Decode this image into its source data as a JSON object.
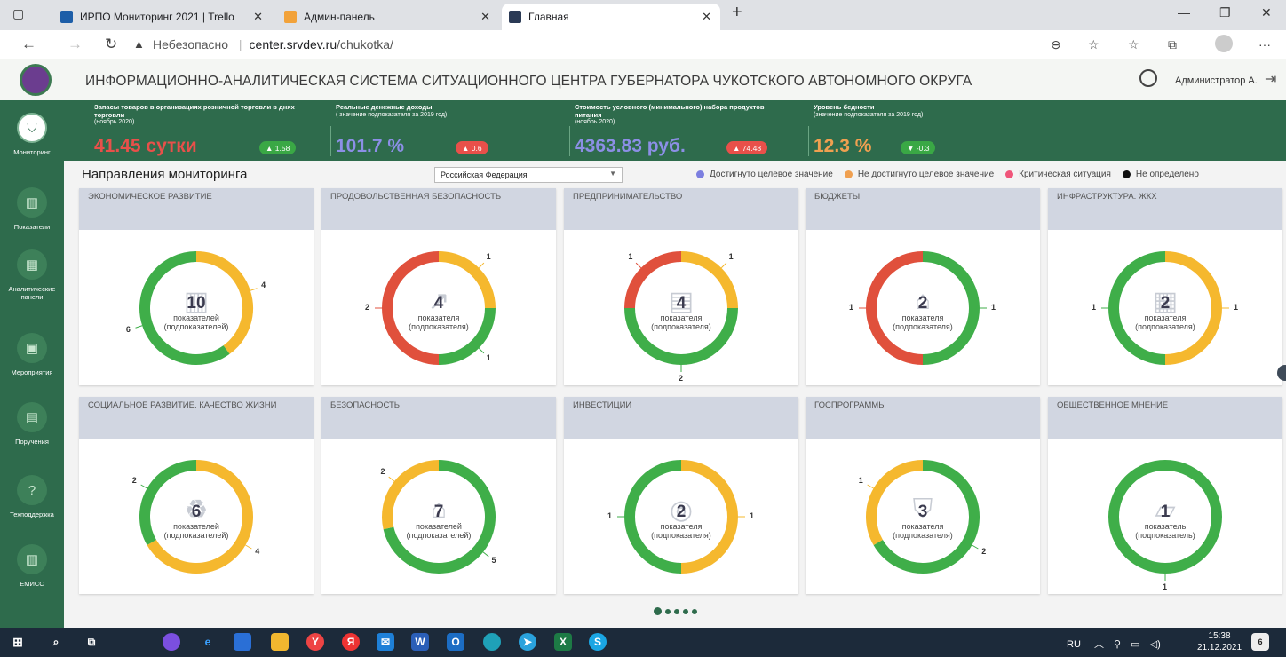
{
  "browser": {
    "tabs": [
      {
        "title": "ИРПО Мониторинг 2021 | Trello"
      },
      {
        "title": "Админ-панель"
      },
      {
        "title": "Главная"
      }
    ],
    "new_tab": "+",
    "security_label": "Небезопасно",
    "url_host": "center.srvdev.ru",
    "url_path": "/chukotka/"
  },
  "header": {
    "title": "ИНФОРМАЦИОННО-АНАЛИТИЧЕСКАЯ СИСТЕМА СИТУАЦИОННОГО ЦЕНТРА ГУБЕРНАТОРА ЧУКОТСКОГО АВТОНОМНОГО ОКРУГА",
    "user": "Администратор А."
  },
  "sidebar": [
    {
      "label": "Мониторинг",
      "icon": "shield-icon"
    },
    {
      "label": "Показатели",
      "icon": "bar-chart-icon"
    },
    {
      "label": "Аналитические панели",
      "icon": "grid-icon"
    },
    {
      "label": "Мероприятия",
      "icon": "calendar-icon"
    },
    {
      "label": "Поручения",
      "icon": "briefcase-icon"
    },
    {
      "label": "Техподдержка",
      "icon": "help-icon"
    },
    {
      "label": "ЕМИСС",
      "icon": "bar-chart-icon"
    }
  ],
  "kpis": [
    {
      "title": "Запасы товаров в организациях розничной торговли в днях торговли",
      "sub": "(ноябрь 2020)",
      "value": "41.45 сутки",
      "value_color": "#e8504a",
      "badge": "▲ 1.58",
      "badge_color": "#3aa845"
    },
    {
      "title": "Реальные денежные доходы",
      "sub": "( значение подпоказателя за 2019 год)",
      "value": "101.7 %",
      "value_color": "#8c8fe6",
      "badge": "▲ 0.6",
      "badge_color": "#e8504a"
    },
    {
      "title": "Стоимость условного (минимального) набора продуктов питания",
      "sub": "(ноябрь 2020)",
      "value": "4363.83 руб.",
      "value_color": "#8c8fe6",
      "badge": "▲ 74.48",
      "badge_color": "#e8504a"
    },
    {
      "title": "Уровень бедности",
      "sub": "(значение подпоказателя за 2019 год)",
      "value": "12.3 %",
      "value_color": "#f0a050",
      "badge": "▼ -0.3",
      "badge_color": "#3aa845"
    }
  ],
  "section": {
    "title": "Направления мониторинга",
    "region": "Российская Федерация",
    "legend": [
      {
        "label": "Достигнуто целевое значение",
        "color": "#7c7fe0"
      },
      {
        "label": "Не достигнуто целевое значение",
        "color": "#f0a050"
      },
      {
        "label": "Критическая ситуация",
        "color": "#f0557a"
      },
      {
        "label": "Не определено",
        "color": "#111111"
      }
    ]
  },
  "colors": {
    "green": "#3fae49",
    "yellow": "#f5b82e",
    "red": "#e0503c"
  },
  "cards": [
    {
      "title": "ЭКОНОМИЧЕСКОЕ РАЗВИТИЕ",
      "count": "10",
      "label1": "показателей",
      "label2": "(подпоказателей)",
      "icon": "bar-chart-icon",
      "segments": [
        {
          "color": "yellow",
          "value": 4
        },
        {
          "color": "green",
          "value": 6
        }
      ],
      "labels": [
        {
          "text": "4"
        },
        {
          "text": "6"
        }
      ]
    },
    {
      "title": "ПРОДОВОЛЬСТВЕННАЯ БЕЗОПАСНОСТЬ",
      "count": "4",
      "label1": "показателя",
      "label2": "(подпоказателя)",
      "icon": "growth-chart-icon",
      "segments": [
        {
          "color": "yellow",
          "value": 1
        },
        {
          "color": "green",
          "value": 1
        },
        {
          "color": "red",
          "value": 2
        }
      ],
      "labels": [
        {
          "text": "1"
        },
        {
          "text": "1"
        },
        {
          "text": "2"
        }
      ]
    },
    {
      "title": "ПРЕДПРИНИМАТЕЛЬСТВО",
      "count": "4",
      "label1": "показателя",
      "label2": "(подпоказателя)",
      "icon": "briefcase-icon",
      "segments": [
        {
          "color": "yellow",
          "value": 1
        },
        {
          "color": "green",
          "value": 2
        },
        {
          "color": "red",
          "value": 1
        }
      ],
      "labels": [
        {
          "text": "1"
        },
        {
          "text": "2"
        },
        {
          "text": "1"
        }
      ]
    },
    {
      "title": "БЮДЖЕТЫ",
      "count": "2",
      "label1": "показателя",
      "label2": "(подпоказателя)",
      "icon": "bank-icon",
      "segments": [
        {
          "color": "green",
          "value": 1
        },
        {
          "color": "red",
          "value": 1
        }
      ],
      "labels": [
        {
          "text": "1"
        },
        {
          "text": "1"
        }
      ]
    },
    {
      "title": "ИНФРАСТРУКТУРА. ЖКХ",
      "count": "2",
      "label1": "показателя",
      "label2": "(подпоказателя)",
      "icon": "building-icon",
      "segments": [
        {
          "color": "yellow",
          "value": 1
        },
        {
          "color": "green",
          "value": 1
        }
      ],
      "labels": [
        {
          "text": "1"
        },
        {
          "text": "1"
        }
      ]
    },
    {
      "title": "СОЦИАЛЬНОЕ РАЗВИТИЕ. КАЧЕСТВО ЖИЗНИ",
      "count": "6",
      "label1": "показателей",
      "label2": "(подпоказателей)",
      "icon": "recycle-icon",
      "segments": [
        {
          "color": "yellow",
          "value": 4
        },
        {
          "color": "green",
          "value": 2
        }
      ],
      "labels": [
        {
          "text": "4"
        },
        {
          "text": "2"
        }
      ]
    },
    {
      "title": "БЕЗОПАСНОСТЬ",
      "count": "7",
      "label1": "показателей",
      "label2": "(подпоказателей)",
      "icon": "house-icon",
      "segments": [
        {
          "color": "green",
          "value": 5
        },
        {
          "color": "yellow",
          "value": 2
        }
      ],
      "labels": [
        {
          "text": "5"
        },
        {
          "text": "2"
        }
      ]
    },
    {
      "title": "ИНВЕСТИЦИИ",
      "count": "2",
      "label1": "показателя",
      "label2": "(подпоказателя)",
      "icon": "target-icon",
      "segments": [
        {
          "color": "yellow",
          "value": 1
        },
        {
          "color": "green",
          "value": 1
        }
      ],
      "labels": [
        {
          "text": "1"
        },
        {
          "text": "1"
        }
      ]
    },
    {
      "title": "ГОСПРОГРАММЫ",
      "count": "3",
      "label1": "показателя",
      "label2": "(подпоказателя)",
      "icon": "emblem-icon",
      "segments": [
        {
          "color": "green",
          "value": 2
        },
        {
          "color": "yellow",
          "value": 1
        }
      ],
      "labels": [
        {
          "text": "2"
        },
        {
          "text": "1"
        }
      ]
    },
    {
      "title": "ОБЩЕСТВЕННОЕ МНЕНИЕ",
      "count": "1",
      "label1": "показатель",
      "label2": "(подпоказатель)",
      "icon": "map-icon",
      "segments": [
        {
          "color": "green",
          "value": 1
        }
      ],
      "labels": [
        {
          "text": "1"
        }
      ]
    }
  ],
  "pager": {
    "pages": 5,
    "active": 1
  },
  "taskbar": {
    "lang": "RU",
    "time": "15:38",
    "date": "21.12.2021",
    "notifications": "6"
  }
}
